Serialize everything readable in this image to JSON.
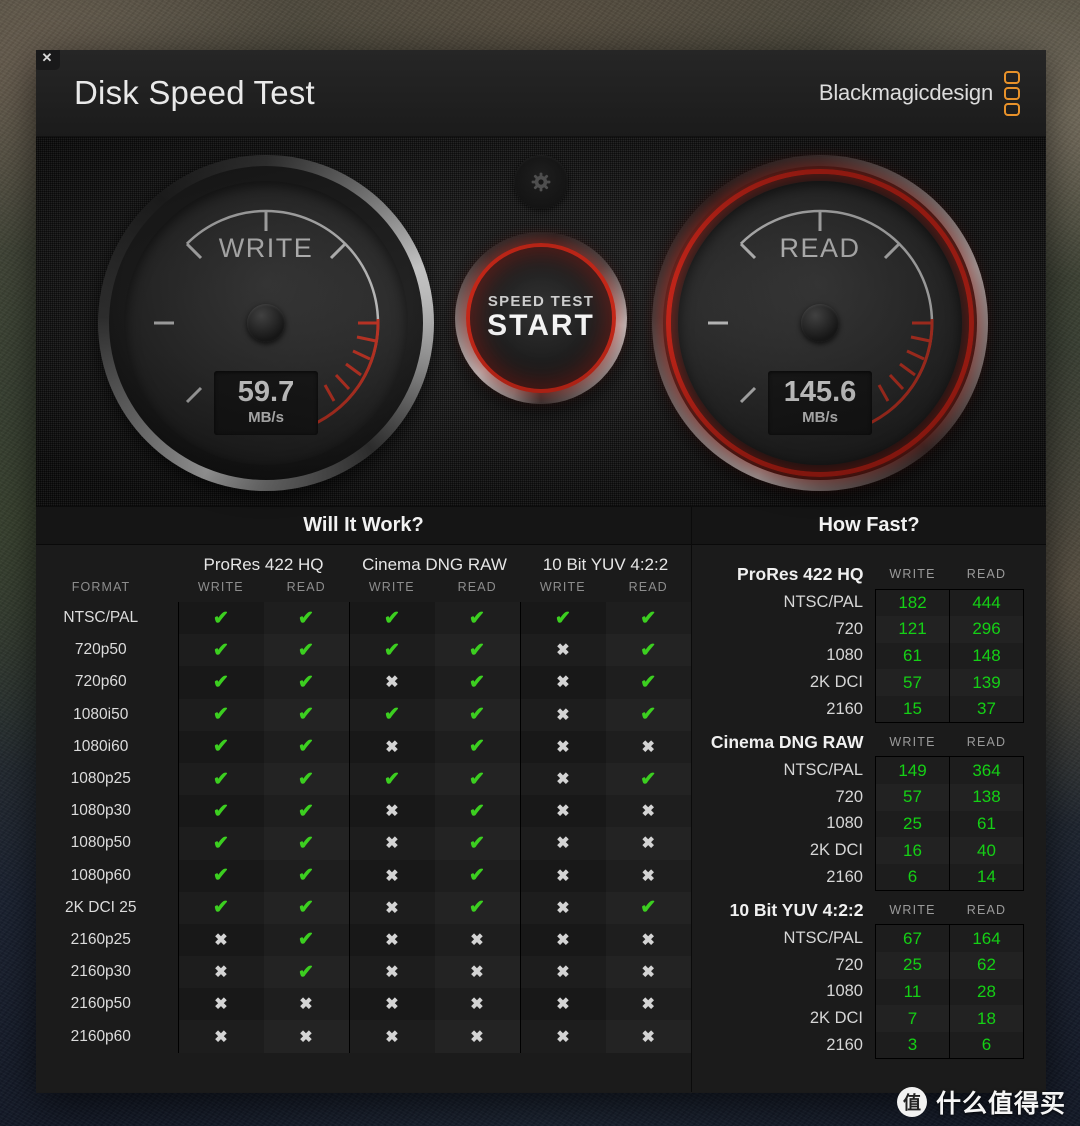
{
  "window": {
    "title": "Disk Speed Test",
    "close_label": "✕",
    "brand": "Blackmagicdesign"
  },
  "gauges": {
    "write": {
      "label": "WRITE",
      "value": "59.7",
      "unit": "MB/s",
      "needle_deg": 215
    },
    "read": {
      "label": "READ",
      "value": "145.6",
      "unit": "MB/s",
      "needle_deg": 215
    }
  },
  "start_button": {
    "sub_label": "SPEED TEST",
    "main_label": "START"
  },
  "gear_button": {
    "name": "settings"
  },
  "will_it_work": {
    "title": "Will It Work?",
    "format_header": "FORMAT",
    "groups": [
      "ProRes 422 HQ",
      "Cinema DNG RAW",
      "10 Bit YUV 4:2:2"
    ],
    "sub_headers": [
      "WRITE",
      "READ"
    ],
    "ok_glyph": "✔",
    "no_glyph": "✖",
    "rows": [
      {
        "format": "NTSC/PAL",
        "cells": [
          true,
          true,
          true,
          true,
          true,
          true
        ]
      },
      {
        "format": "720p50",
        "cells": [
          true,
          true,
          true,
          true,
          false,
          true
        ]
      },
      {
        "format": "720p60",
        "cells": [
          true,
          true,
          false,
          true,
          false,
          true
        ]
      },
      {
        "format": "1080i50",
        "cells": [
          true,
          true,
          true,
          true,
          false,
          true
        ]
      },
      {
        "format": "1080i60",
        "cells": [
          true,
          true,
          false,
          true,
          false,
          false
        ]
      },
      {
        "format": "1080p25",
        "cells": [
          true,
          true,
          true,
          true,
          false,
          true
        ]
      },
      {
        "format": "1080p30",
        "cells": [
          true,
          true,
          false,
          true,
          false,
          false
        ]
      },
      {
        "format": "1080p50",
        "cells": [
          true,
          true,
          false,
          true,
          false,
          false
        ]
      },
      {
        "format": "1080p60",
        "cells": [
          true,
          true,
          false,
          true,
          false,
          false
        ]
      },
      {
        "format": "2K DCI 25",
        "cells": [
          true,
          true,
          false,
          true,
          false,
          true
        ]
      },
      {
        "format": "2160p25",
        "cells": [
          false,
          true,
          false,
          false,
          false,
          false
        ]
      },
      {
        "format": "2160p30",
        "cells": [
          false,
          true,
          false,
          false,
          false,
          false
        ]
      },
      {
        "format": "2160p50",
        "cells": [
          false,
          false,
          false,
          false,
          false,
          false
        ]
      },
      {
        "format": "2160p60",
        "cells": [
          false,
          false,
          false,
          false,
          false,
          false
        ]
      }
    ]
  },
  "how_fast": {
    "title": "How Fast?",
    "col_headers": [
      "WRITE",
      "READ"
    ],
    "groups": [
      {
        "name": "ProRes 422 HQ",
        "rows": [
          {
            "label": "NTSC/PAL",
            "write": "182",
            "read": "444"
          },
          {
            "label": "720",
            "write": "121",
            "read": "296"
          },
          {
            "label": "1080",
            "write": "61",
            "read": "148"
          },
          {
            "label": "2K DCI",
            "write": "57",
            "read": "139"
          },
          {
            "label": "2160",
            "write": "15",
            "read": "37"
          }
        ]
      },
      {
        "name": "Cinema DNG RAW",
        "rows": [
          {
            "label": "NTSC/PAL",
            "write": "149",
            "read": "364"
          },
          {
            "label": "720",
            "write": "57",
            "read": "138"
          },
          {
            "label": "1080",
            "write": "25",
            "read": "61"
          },
          {
            "label": "2K DCI",
            "write": "16",
            "read": "40"
          },
          {
            "label": "2160",
            "write": "6",
            "read": "14"
          }
        ]
      },
      {
        "name": "10 Bit YUV 4:2:2",
        "rows": [
          {
            "label": "NTSC/PAL",
            "write": "67",
            "read": "164"
          },
          {
            "label": "720",
            "write": "25",
            "read": "62"
          },
          {
            "label": "1080",
            "write": "11",
            "read": "28"
          },
          {
            "label": "2K DCI",
            "write": "7",
            "read": "18"
          },
          {
            "label": "2160",
            "write": "3",
            "read": "6"
          }
        ]
      }
    ]
  },
  "watermark": {
    "logo": "值",
    "text": "什么值得买"
  },
  "colors": {
    "accent_orange": "#e8922a",
    "needle_blue": "#3ec1f5",
    "danger_red": "#cc2212",
    "ok_green": "#3ccf20",
    "value_green": "#15d015"
  }
}
